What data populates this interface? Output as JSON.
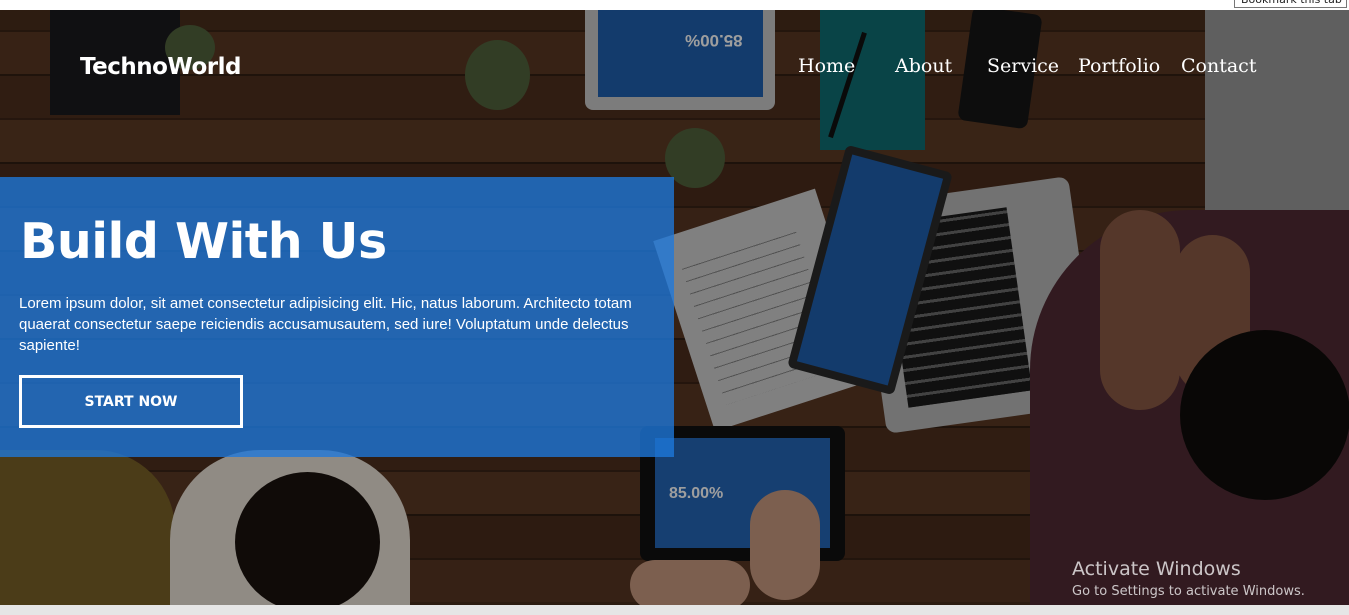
{
  "tooltip": {
    "label": "Bookmark this tab"
  },
  "header": {
    "logo": "TechnoWorld",
    "nav": [
      {
        "label": "Home"
      },
      {
        "label": "About"
      },
      {
        "label": "Service"
      },
      {
        "label": "Portfolio"
      },
      {
        "label": "Contact"
      }
    ]
  },
  "hero": {
    "title": "Build With Us",
    "body": "Lorem ipsum dolor, sit amet consectetur adipisicing elit. Hic, natus laborum. Architecto totam quaerat consectetur saepe reiciendis accusamusautem, sed iure! Voluptatum unde delectus sapiente!",
    "cta_label": "START NOW",
    "overlay_color": "#1e78dc",
    "background_image": "overhead photo of people working around a wooden table with laptops and tablets"
  },
  "background_text": {
    "tablet_top_value": "85.00%",
    "tablet_bottom_value": "85.00%"
  },
  "watermark": {
    "line1": "Activate Windows",
    "line2": "Go to Settings to activate Windows."
  }
}
